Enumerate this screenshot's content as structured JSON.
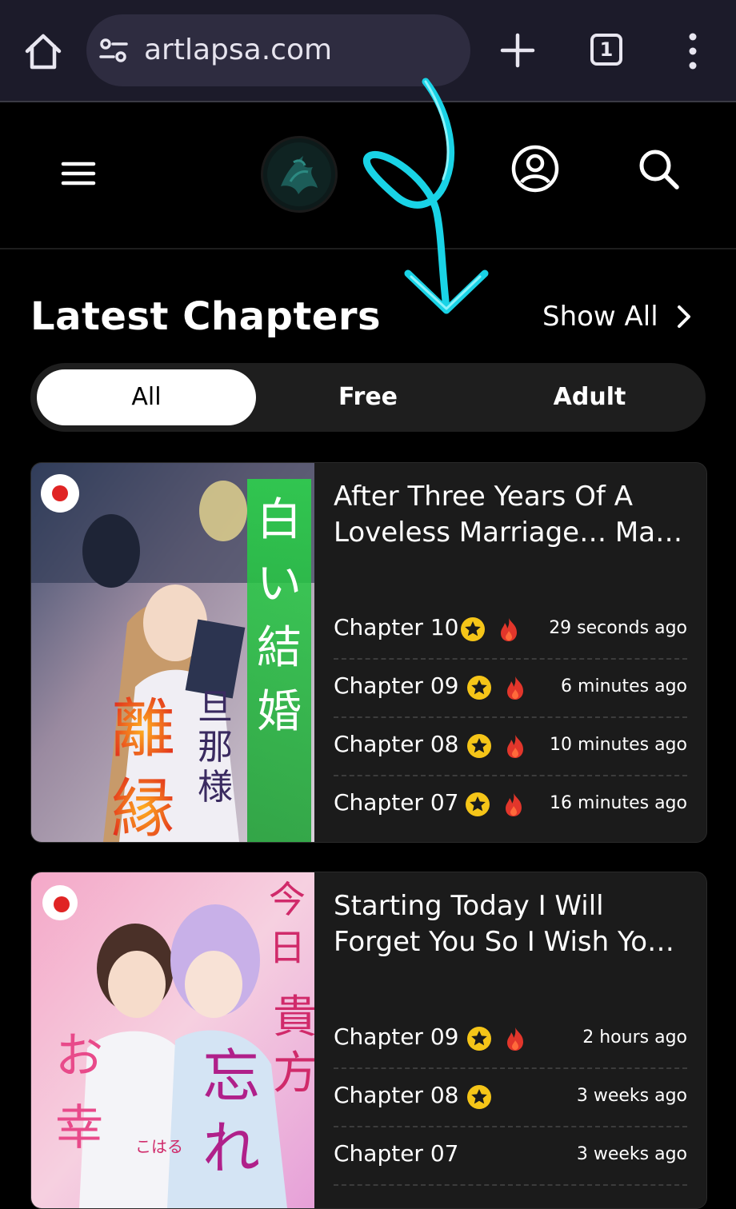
{
  "browser": {
    "url": "artlapsa.com",
    "tab_count": "1"
  },
  "section": {
    "title": "Latest Chapters",
    "show_all": "Show All"
  },
  "tabs": [
    {
      "label": "All",
      "active": true
    },
    {
      "label": "Free",
      "active": false
    },
    {
      "label": "Adult",
      "active": false
    }
  ],
  "cards": [
    {
      "title": "After Three Years Of A Loveless Marriage… Ma…",
      "chapters": [
        {
          "label": "Chapter 10",
          "time": "29 seconds ago",
          "star": true,
          "fire": true
        },
        {
          "label": "Chapter 09",
          "time": "6 minutes ago",
          "star": true,
          "fire": true
        },
        {
          "label": "Chapter 08",
          "time": "10 minutes ago",
          "star": true,
          "fire": true
        },
        {
          "label": "Chapter 07",
          "time": "16 minutes ago",
          "star": true,
          "fire": true
        }
      ]
    },
    {
      "title": "Starting Today I Will Forget You So I Wish Yo…",
      "chapters": [
        {
          "label": "Chapter 09",
          "time": "2 hours ago",
          "star": true,
          "fire": true
        },
        {
          "label": "Chapter 08",
          "time": "3 weeks ago",
          "star": true,
          "fire": false
        },
        {
          "label": "Chapter 07",
          "time": "3 weeks ago",
          "star": false,
          "fire": false
        }
      ]
    }
  ],
  "colors": {
    "accent_star": "#f5c518",
    "fire": "#e2362b",
    "scribble": "#19d3e6"
  }
}
